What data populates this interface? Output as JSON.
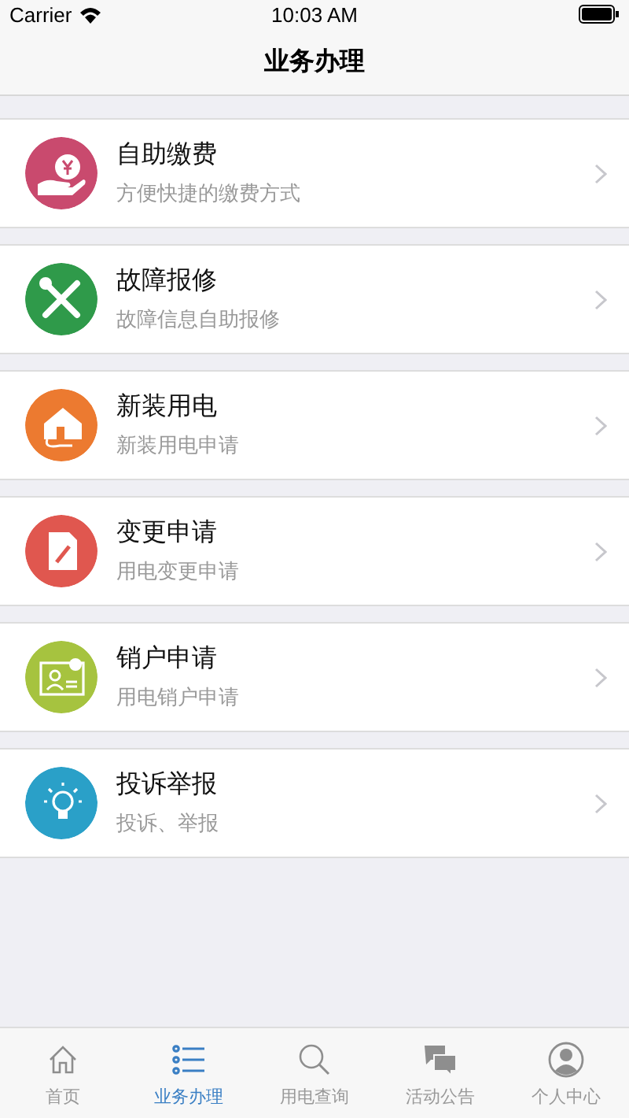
{
  "status_bar": {
    "carrier": "Carrier",
    "time": "10:03 AM"
  },
  "nav_bar": {
    "title": "业务办理"
  },
  "services": [
    {
      "kind": "payment",
      "color": "#c94a6e",
      "title": "自助缴费",
      "subtitle": "方便快捷的缴费方式"
    },
    {
      "kind": "repair",
      "color": "#2f9a4a",
      "title": "故障报修",
      "subtitle": "故障信息自助报修"
    },
    {
      "kind": "house",
      "color": "#ec7a30",
      "title": "新装用电",
      "subtitle": "新装用电申请"
    },
    {
      "kind": "document",
      "color": "#e0574f",
      "title": "变更申请",
      "subtitle": "用电变更申请"
    },
    {
      "kind": "card",
      "color": "#a6c33f",
      "title": "销户申请",
      "subtitle": "用电销户申请"
    },
    {
      "kind": "bulb",
      "color": "#2aa0c8",
      "title": "投诉举报",
      "subtitle": "投诉、举报"
    }
  ],
  "tab_bar": [
    {
      "kind": "home",
      "label": "首页",
      "selected": false
    },
    {
      "kind": "list",
      "label": "业务办理",
      "selected": true
    },
    {
      "kind": "search",
      "label": "用电查询",
      "selected": false
    },
    {
      "kind": "chat",
      "label": "活动公告",
      "selected": false
    },
    {
      "kind": "person",
      "label": "个人中心",
      "selected": false
    }
  ]
}
